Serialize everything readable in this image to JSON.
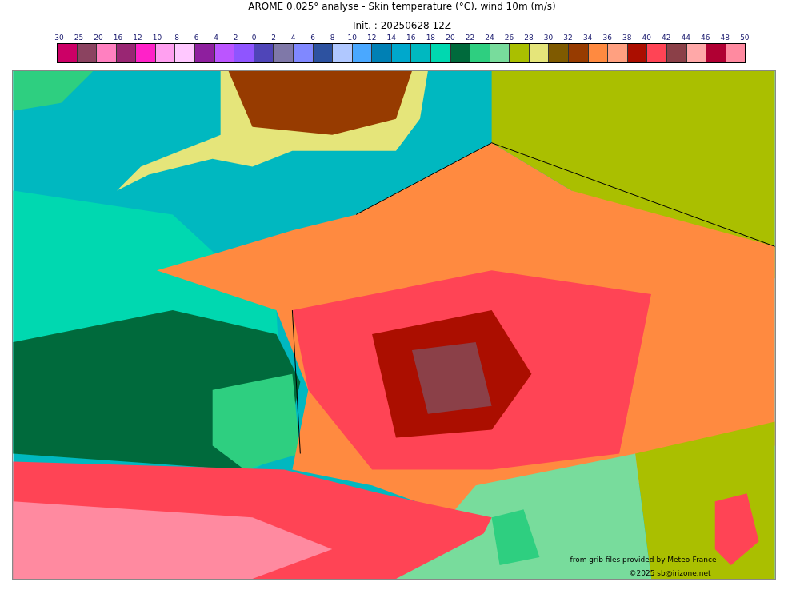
{
  "title": "AROME 0.025° analyse - Skin temperature (°C), wind 10m (m/s)",
  "subtitle": "Init. : 20250628 12Z",
  "colorbar": {
    "ticks": [
      "-30",
      "-25",
      "-20",
      "-16",
      "-12",
      "-10",
      "-8",
      "-6",
      "-4",
      "-2",
      "0",
      "2",
      "4",
      "6",
      "8",
      "10",
      "12",
      "14",
      "16",
      "18",
      "20",
      "22",
      "24",
      "26",
      "28",
      "30",
      "32",
      "34",
      "36",
      "38",
      "40",
      "42",
      "44",
      "46",
      "48",
      "50"
    ],
    "cells": [
      {
        "color": "#cc0066"
      },
      {
        "color": "#8b4360"
      },
      {
        "color": "#ff80c0"
      },
      {
        "color": "#992673"
      },
      {
        "color": "#ff22c8"
      },
      {
        "color": "#ffa0f0"
      },
      {
        "color": "#ffc8ff"
      },
      {
        "color": "#8e1f9e"
      },
      {
        "color": "#bb55ff"
      },
      {
        "color": "#8f55ff"
      },
      {
        "color": "#4f45b8"
      },
      {
        "color": "#7f78a8"
      },
      {
        "color": "#8088ff"
      },
      {
        "color": "#2d52a0"
      },
      {
        "color": "#b0c8ff"
      },
      {
        "color": "#4aa8ff"
      },
      {
        "color": "#0080b4"
      },
      {
        "color": "#00a8cc"
      },
      {
        "color": "#00b8c0"
      },
      {
        "color": "#00d8b0"
      },
      {
        "color": "#006a3c"
      },
      {
        "color": "#2ecf80"
      },
      {
        "color": "#78dc9c"
      },
      {
        "color": "#aabf00"
      },
      {
        "color": "#e5e57a"
      },
      {
        "color": "#7f5a00"
      },
      {
        "color": "#973b00"
      },
      {
        "color": "#ff8a40"
      },
      {
        "color": "#ffa080"
      },
      {
        "color": "#ab0e00"
      },
      {
        "color": "#ff4455"
      },
      {
        "color": "#8b4048"
      },
      {
        "color": "#ffa8a8"
      },
      {
        "color": "#b00033"
      },
      {
        "color": "#ff8aa0"
      }
    ]
  },
  "map": {
    "credit": "from grib files provided by Meteo-France",
    "copyright": "©2025 sb@irizone.net"
  }
}
